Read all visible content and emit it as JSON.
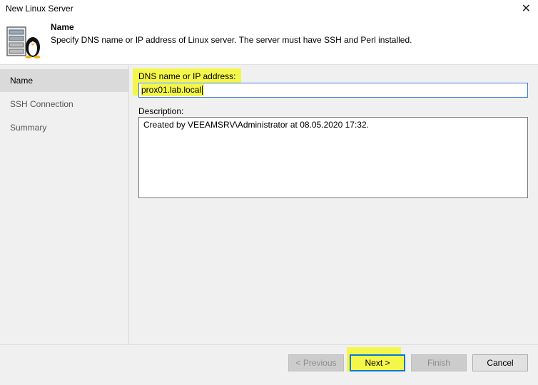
{
  "window": {
    "title": "New Linux Server",
    "close_glyph": "✕"
  },
  "header": {
    "title": "Name",
    "description": "Specify DNS name or IP address of Linux server. The server must have SSH and Perl installed.",
    "icon": "linux-server-icon"
  },
  "sidebar": {
    "items": [
      {
        "label": "Name",
        "active": true
      },
      {
        "label": "SSH Connection",
        "active": false
      },
      {
        "label": "Summary",
        "active": false
      }
    ]
  },
  "form": {
    "dns_label": "DNS name or IP address:",
    "dns_value": "prox01.lab.local",
    "description_label": "Description:",
    "description_value": "Created by VEEAMSRV\\Administrator at 08.05.2020 17:32."
  },
  "buttons": {
    "previous": "< Previous",
    "next": "Next >",
    "finish": "Finish",
    "cancel": "Cancel"
  },
  "colors": {
    "highlight": "#f4f64a",
    "focus_border": "#0078d7"
  }
}
